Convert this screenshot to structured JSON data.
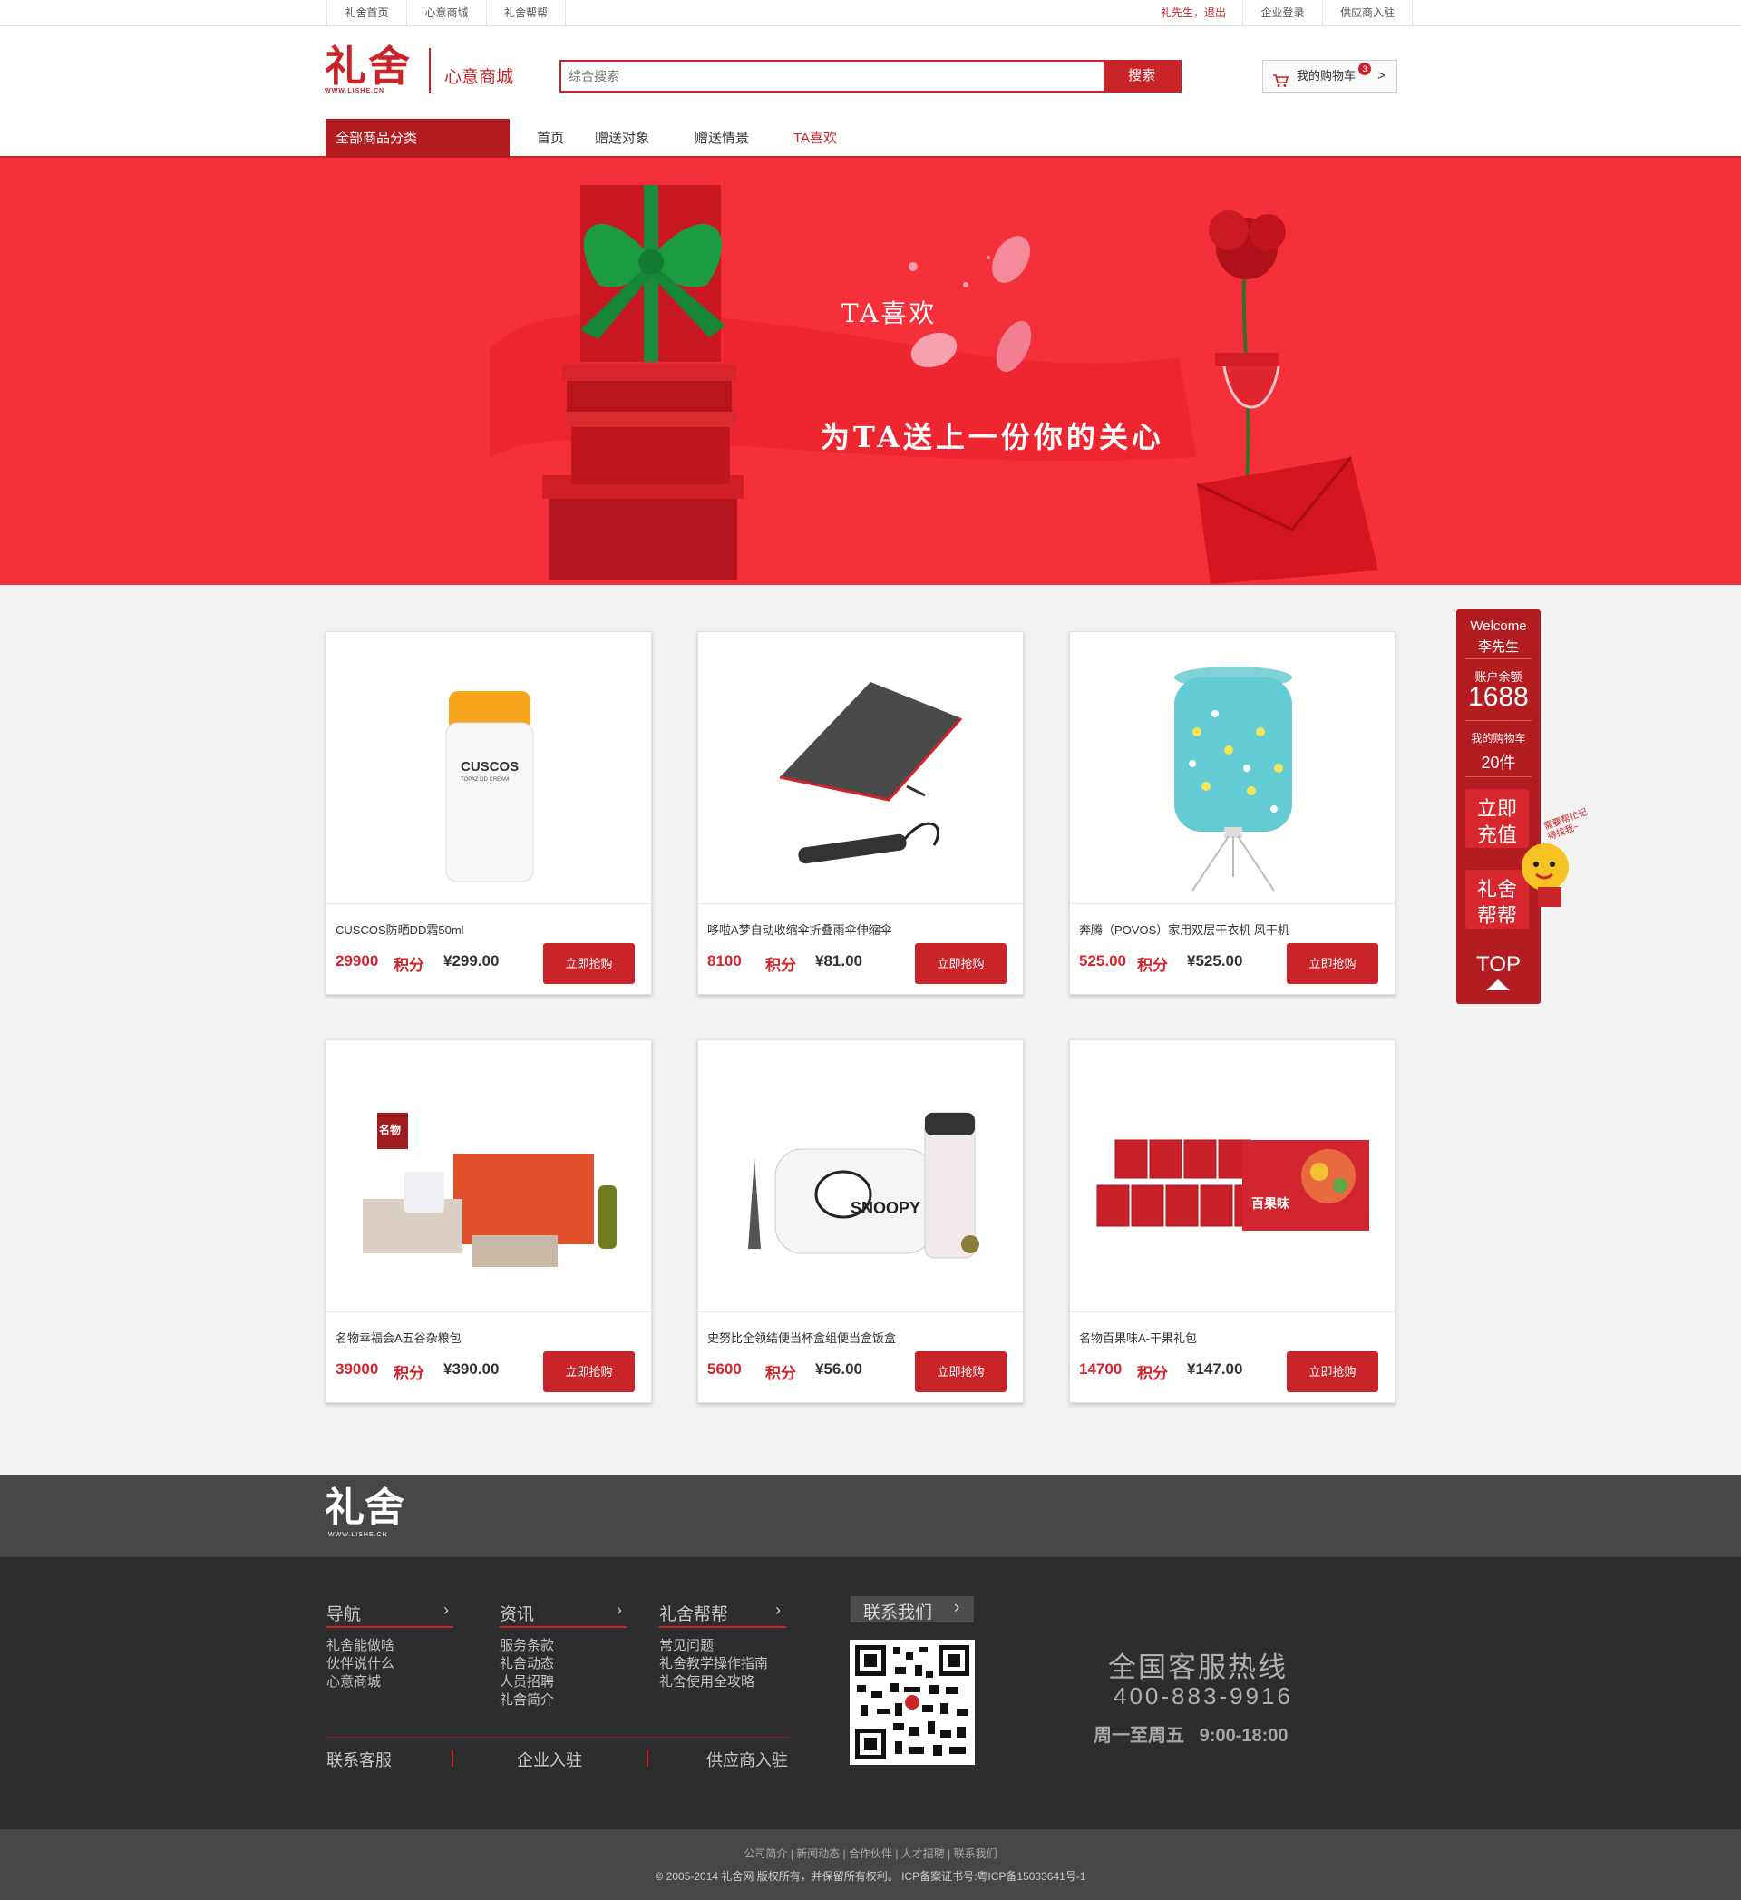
{
  "topbar": {
    "links": [
      "礼舍首页",
      "心意商城",
      "礼舍帮帮"
    ],
    "user": "礼先生，退出",
    "enterprise": "企业登录",
    "supplier": "供应商入驻"
  },
  "header": {
    "logo": "礼舍",
    "logo_sub": "WWW.LISHE.CN",
    "site_name": "心意商城",
    "search_placeholder": "综合搜索",
    "search_button": "搜索",
    "cart_label": "我的购物车",
    "cart_count": "3",
    "cart_arrow": ">"
  },
  "nav": {
    "all_categories": "全部商品分类",
    "items": [
      "首页",
      "赠送对象",
      "赠送情景",
      "TA喜欢"
    ]
  },
  "banner": {
    "title": "TA喜欢",
    "slogan": "为TA送上一份你的关心"
  },
  "products": [
    {
      "name": "CUSCOS防晒DD霜50ml",
      "points": "29900",
      "points_label": "积分",
      "price": "¥299.00",
      "buy": "立即抢购"
    },
    {
      "name": "哆啦A梦自动收缩伞折叠雨伞伸缩伞",
      "points": "8100",
      "points_label": "积分",
      "price": "¥81.00",
      "buy": "立即抢购"
    },
    {
      "name": "奔腾（POVOS）家用双层干衣机 风干机",
      "points": "525.00",
      "points_label": "积分",
      "price": "¥525.00",
      "buy": "立即抢购"
    },
    {
      "name": "名物幸福会A五谷杂粮包",
      "points": "39000",
      "points_label": "积分",
      "price": "¥390.00",
      "buy": "立即抢购"
    },
    {
      "name": "史努比全领结便当杯盒组便当盒饭盒",
      "points": "5600",
      "points_label": "积分",
      "price": "¥56.00",
      "buy": "立即抢购"
    },
    {
      "name": "名物百果味A-干果礼包",
      "points": "14700",
      "points_label": "积分",
      "price": "¥147.00",
      "buy": "立即抢购"
    }
  ],
  "product_images": {
    "p1_brand": "CUSCOS",
    "p1_sub": "TOPAZ DD CREAM",
    "p4_badge": "名物",
    "p5_brand": "SNOOPY",
    "p6_label": "百果味"
  },
  "side": {
    "welcome": "Welcome",
    "user": "李先生",
    "balance_label": "账户余额",
    "balance": "1688",
    "cart_label": "我的购物车",
    "cart_count": "20件",
    "recharge_1": "立即",
    "recharge_2": "充值",
    "help_1": "礼舍",
    "help_2": "帮帮",
    "mascot_note": "需要帮忙记得找我~",
    "top": "TOP"
  },
  "footer": {
    "logo": "礼舍",
    "logo_sub": "WWW.LISHE.CN",
    "columns": [
      {
        "title": "导航",
        "links": [
          "礼舍能做啥",
          "伙伴说什么",
          "心意商城"
        ]
      },
      {
        "title": "资讯",
        "links": [
          "服务条款",
          "礼舍动态",
          "人员招聘",
          "礼舍简介"
        ]
      },
      {
        "title": "礼舍帮帮",
        "links": [
          "常见问题",
          "礼舍教学操作指南",
          "礼舍使用全攻略"
        ]
      }
    ],
    "bottom_links": [
      "联系客服",
      "企业入驻",
      "供应商入驻"
    ],
    "contact_us": "联系我们",
    "hotline_title": "全国客服热线",
    "hotline": "400-883-9916",
    "hours": "周一至周五   9:00-18:00",
    "sub_links": "公司简介 | 新闻动态 | 合作伙伴 | 人才招聘 | 联系我们",
    "copyright": "© 2005-2014 礼舍网 版权所有，并保留所有权利。 ICP备案证书号:粤ICP备15033641号-1"
  },
  "colors": {
    "brand": "#c9242a",
    "banner": "#f6303b",
    "footer": "#2d2d2d"
  }
}
